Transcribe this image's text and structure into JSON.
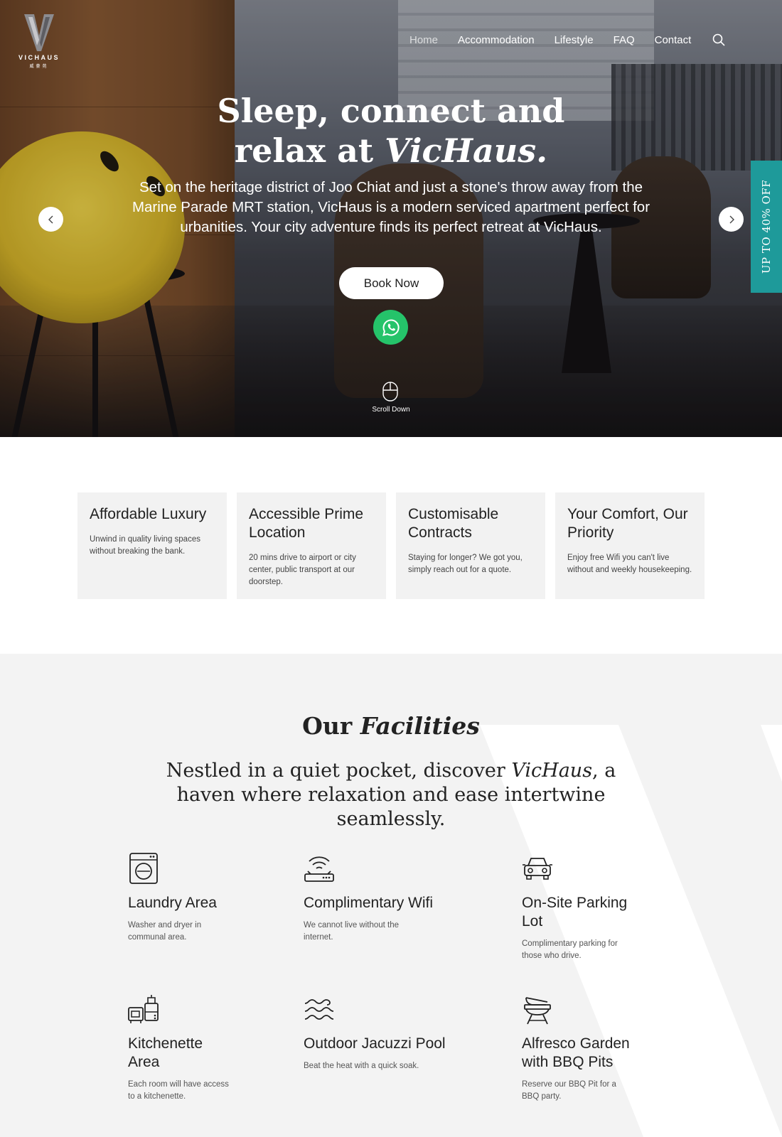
{
  "brand": {
    "name": "VICHAUS",
    "subtitle": "威豪苑"
  },
  "nav": {
    "items": [
      {
        "label": "Home",
        "active": true
      },
      {
        "label": "Accommodation",
        "active": false
      },
      {
        "label": "Lifestyle",
        "active": false
      },
      {
        "label": "FAQ",
        "active": false
      },
      {
        "label": "Contact",
        "active": false
      }
    ],
    "search_icon": "search-icon"
  },
  "hero": {
    "title_line1": "Sleep, connect and",
    "title_line2_plain": "relax at ",
    "title_line2_italic": "VicHaus.",
    "description": "Set on the heritage district of Joo Chiat and just a stone's throw away from the Marine Parade MRT station, VicHaus is a modern serviced apartment perfect for urbanities. Your city adventure finds its perfect retreat at VicHaus.",
    "book_label": "Book Now",
    "scroll_label": "Scroll Down",
    "promo": "UP TO 40% OFF",
    "whatsapp_color": "#25c36a",
    "promo_color": "#1e9a9a"
  },
  "features": [
    {
      "title": "Affordable Luxury",
      "desc": "Unwind in quality living spaces without breaking the bank."
    },
    {
      "title": "Accessible Prime Location",
      "desc": "20 mins drive to airport or city center, public transport at our doorstep."
    },
    {
      "title": "Customisable Contracts",
      "desc": "Staying for longer?  We got you, simply reach out for a quote."
    },
    {
      "title": "Your Comfort, Our Priority",
      "desc": "Enjoy free Wifi you can't live without and weekly housekeeping."
    }
  ],
  "facilities": {
    "heading_plain": "Our ",
    "heading_italic": "Facilities",
    "intro_a": "Nestled in a quiet pocket, discover ",
    "intro_italic": "VicHaus",
    "intro_b": ", a haven where relaxation and ease intertwine seamlessly.",
    "items": [
      {
        "icon": "laundry-icon",
        "title": "Laundry Area",
        "desc": "Washer and dryer in communal area."
      },
      {
        "icon": "wifi-router-icon",
        "title": "Complimentary Wifi",
        "desc": "We cannot live without the internet."
      },
      {
        "icon": "car-icon",
        "title": "On-Site Parking Lot",
        "desc": "Complimentary parking for those who drive."
      },
      {
        "icon": "kitchen-icon",
        "title": "Kitchenette Area",
        "desc": "Each room will have access to a kitchenette."
      },
      {
        "icon": "waves-icon",
        "title": "Outdoor Jacuzzi Pool",
        "desc": "Beat the heat with a quick soak."
      },
      {
        "icon": "bbq-grill-icon",
        "title": "Alfresco Garden with BBQ Pits",
        "desc": "Reserve our BBQ Pit for a BBQ party."
      }
    ]
  }
}
